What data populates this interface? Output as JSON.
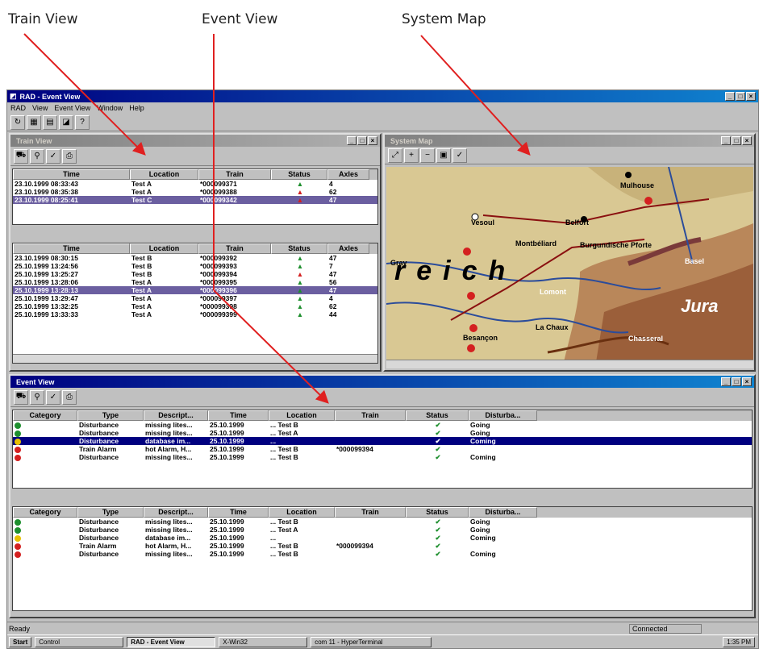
{
  "annotations": {
    "train_view": "Train View",
    "event_view": "Event View",
    "system_map": "System Map"
  },
  "app": {
    "title": "RAD - Event View",
    "menu": [
      "RAD",
      "View",
      "Event View",
      "Window",
      "Help"
    ]
  },
  "train_view": {
    "title": "Train View",
    "columns": [
      "Time",
      "Location",
      "Train",
      "Status",
      "Axles"
    ],
    "top_rows": [
      {
        "time": "23.10.1999 08:33:43",
        "location": "Test A",
        "train": "*000099371",
        "status": "green",
        "axles": "4"
      },
      {
        "time": "23.10.1999 08:35:38",
        "location": "Test A",
        "train": "*000099388",
        "status": "red",
        "axles": "62"
      },
      {
        "time": "23.10.1999 08:25:41",
        "location": "Test C",
        "train": "*000099342",
        "status": "red",
        "axles": "47"
      }
    ],
    "bottom_rows": [
      {
        "time": "23.10.1999 08:30:15",
        "location": "Test B",
        "train": "*000099392",
        "status": "green",
        "axles": "47"
      },
      {
        "time": "25.10.1999 13:24:56",
        "location": "Test B",
        "train": "*000099393",
        "status": "green",
        "axles": "7"
      },
      {
        "time": "25.10.1999 13:25:27",
        "location": "Test B",
        "train": "*000099394",
        "status": "red",
        "axles": "47"
      },
      {
        "time": "25.10.1999 13:28:06",
        "location": "Test A",
        "train": "*000099395",
        "status": "green",
        "axles": "56"
      },
      {
        "time": "25.10.1999 13:28:13",
        "location": "Test A",
        "train": "*000099396",
        "status": "green",
        "axles": "47"
      },
      {
        "time": "25.10.1999 13:29:47",
        "location": "Test A",
        "train": "*000099397",
        "status": "green",
        "axles": "4"
      },
      {
        "time": "25.10.1999 13:32:25",
        "location": "Test A",
        "train": "*000099398",
        "status": "green",
        "axles": "62"
      },
      {
        "time": "25.10.1999 13:33:33",
        "location": "Test A",
        "train": "*000099399",
        "status": "green",
        "axles": "44"
      }
    ]
  },
  "system_map": {
    "title": "System Map",
    "labels": [
      "Mulhouse",
      "Belfort",
      "Vesoul",
      "Montbéliard",
      "Burgundische Pforte",
      "Basel",
      "Besançon",
      "Lomont",
      "Jura",
      "La Chaux",
      "Chasseral",
      "reich",
      "Gray"
    ]
  },
  "event_view": {
    "title": "Event View",
    "columns": [
      "Category",
      "Type",
      "Descript...",
      "Time",
      "Location",
      "Train",
      "Status",
      "Disturba..."
    ],
    "top_rows": [
      {
        "cat": "green",
        "type": "Disturbance",
        "desc": "missing lites...",
        "time": "25.10.1999",
        "loc": "... Test B",
        "train": "",
        "status": "check",
        "dist": "Going"
      },
      {
        "cat": "green",
        "type": "Disturbance",
        "desc": "missing lites...",
        "time": "25.10.1999",
        "loc": "... Test A",
        "train": "",
        "status": "check",
        "dist": "Going"
      },
      {
        "cat": "yellow",
        "type": "Disturbance",
        "desc": "database im...",
        "time": "25.10.1999",
        "loc": "...",
        "train": "",
        "status": "check",
        "dist": "Coming"
      },
      {
        "cat": "red",
        "type": "Train Alarm",
        "desc": "hot Alarm, H...",
        "time": "25.10.1999",
        "loc": "... Test B",
        "train": "*000099394",
        "status": "check",
        "dist": ""
      },
      {
        "cat": "red",
        "type": "Disturbance",
        "desc": "missing lites...",
        "time": "25.10.1999",
        "loc": "... Test B",
        "train": "",
        "status": "check",
        "dist": "Coming"
      }
    ],
    "bottom_rows": [
      {
        "cat": "green",
        "type": "Disturbance",
        "desc": "missing lites...",
        "time": "25.10.1999",
        "loc": "... Test B",
        "train": "",
        "status": "check",
        "dist": "Going"
      },
      {
        "cat": "green",
        "type": "Disturbance",
        "desc": "missing lites...",
        "time": "25.10.1999",
        "loc": "... Test A",
        "train": "",
        "status": "check",
        "dist": "Going"
      },
      {
        "cat": "yellow",
        "type": "Disturbance",
        "desc": "database im...",
        "time": "25.10.1999",
        "loc": "...",
        "train": "",
        "status": "check",
        "dist": "Coming"
      },
      {
        "cat": "red",
        "type": "Train Alarm",
        "desc": "hot Alarm, H...",
        "time": "25.10.1999",
        "loc": "... Test B",
        "train": "*000099394",
        "status": "check",
        "dist": ""
      },
      {
        "cat": "red",
        "type": "Disturbance",
        "desc": "missing lites...",
        "time": "25.10.1999",
        "loc": "... Test B",
        "train": "",
        "status": "check",
        "dist": "Coming"
      }
    ]
  },
  "status_bar": {
    "text": "Ready",
    "connection": "Connected"
  },
  "taskbar": {
    "start": "Start",
    "tasks": [
      "Control",
      "RAD - Event View",
      "X-Win32",
      "com 11 - HyperTerminal"
    ],
    "clock": "1:35 PM"
  },
  "colors": {
    "title_active": "#000080",
    "selection": "#6b5fa0",
    "green": "#1e8f2e",
    "red": "#d42020",
    "yellow": "#e8c000"
  }
}
